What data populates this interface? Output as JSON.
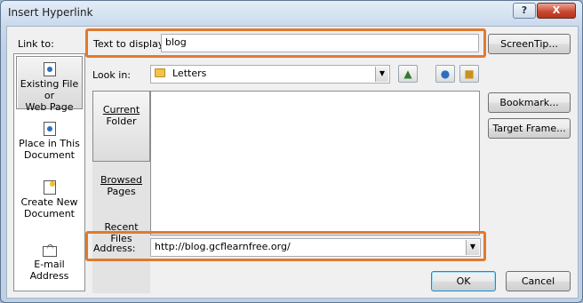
{
  "window": {
    "title": "Insert Hyperlink",
    "help_label": "?",
    "close_label": "X"
  },
  "link_to": {
    "label": "Link to:",
    "items": [
      {
        "line1": "Existing File or",
        "line2": "Web Page",
        "icon": "globe-page-icon"
      },
      {
        "line1": "Place in This",
        "line2": "Document",
        "icon": "document-place-icon"
      },
      {
        "line1": "Create New",
        "line2": "Document",
        "icon": "new-document-icon"
      },
      {
        "line1": "E-mail Address",
        "line2": "",
        "icon": "email-icon"
      }
    ]
  },
  "text_to_display": {
    "label": "Text to display:",
    "value": "blog"
  },
  "screentip_label": "ScreenTip...",
  "look_in": {
    "label": "Look in:",
    "value": "Letters"
  },
  "side_tabs": [
    {
      "line1": "Current",
      "line2": "Folder"
    },
    {
      "line1": "Browsed",
      "line2": "Pages"
    },
    {
      "line1": "Recent",
      "line2": "Files"
    }
  ],
  "buttons": {
    "bookmark": "Bookmark...",
    "target_frame": "Target Frame...",
    "ok": "OK",
    "cancel": "Cancel"
  },
  "address": {
    "label": "Address:",
    "value": "http://blog.gcflearnfree.org/"
  },
  "colors": {
    "highlight": "#e07a2f",
    "accent": "#3c7fb1"
  }
}
